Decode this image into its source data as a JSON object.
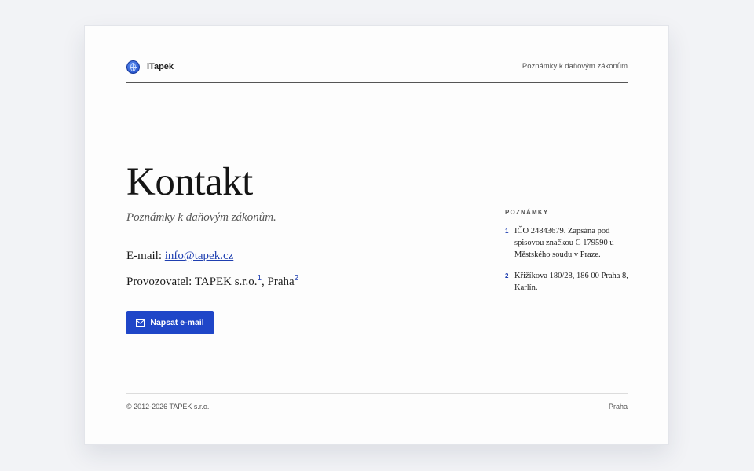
{
  "header": {
    "brand": "iTapek",
    "tagline": "Poznámky k daňovým zákonům"
  },
  "main": {
    "title": "Kontakt",
    "subtitle": "Poznámky k daňovým zákonům.",
    "email_label": "E-mail:",
    "email_value": "info@tapek.cz",
    "operator_label": "Provozovatel:",
    "operator_name": "TAPEK s.r.o.",
    "operator_ref1": "1",
    "operator_sep": ",",
    "operator_city": "Praha",
    "operator_ref2": "2",
    "button_label": "Napsat e-mail"
  },
  "notes": {
    "title": "POZNÁMKY",
    "items": [
      {
        "num": "1",
        "text": "IČO 24843679. Zapsána pod spisovou značkou C 179590 u Městského soudu v Praze."
      },
      {
        "num": "2",
        "text": "Křižíkova 180/28, 186 00 Praha 8, Karlín."
      }
    ]
  },
  "footer": {
    "copyright": "© 2012-2026 TAPEK s.r.o.",
    "city": "Praha"
  },
  "colors": {
    "accent": "#1f46c8",
    "link": "#1f3fb0",
    "background": "#f2f3f6",
    "card": "#fdfdfd"
  },
  "icons": {
    "logo": "globe-logo-icon",
    "button": "mail-icon"
  }
}
